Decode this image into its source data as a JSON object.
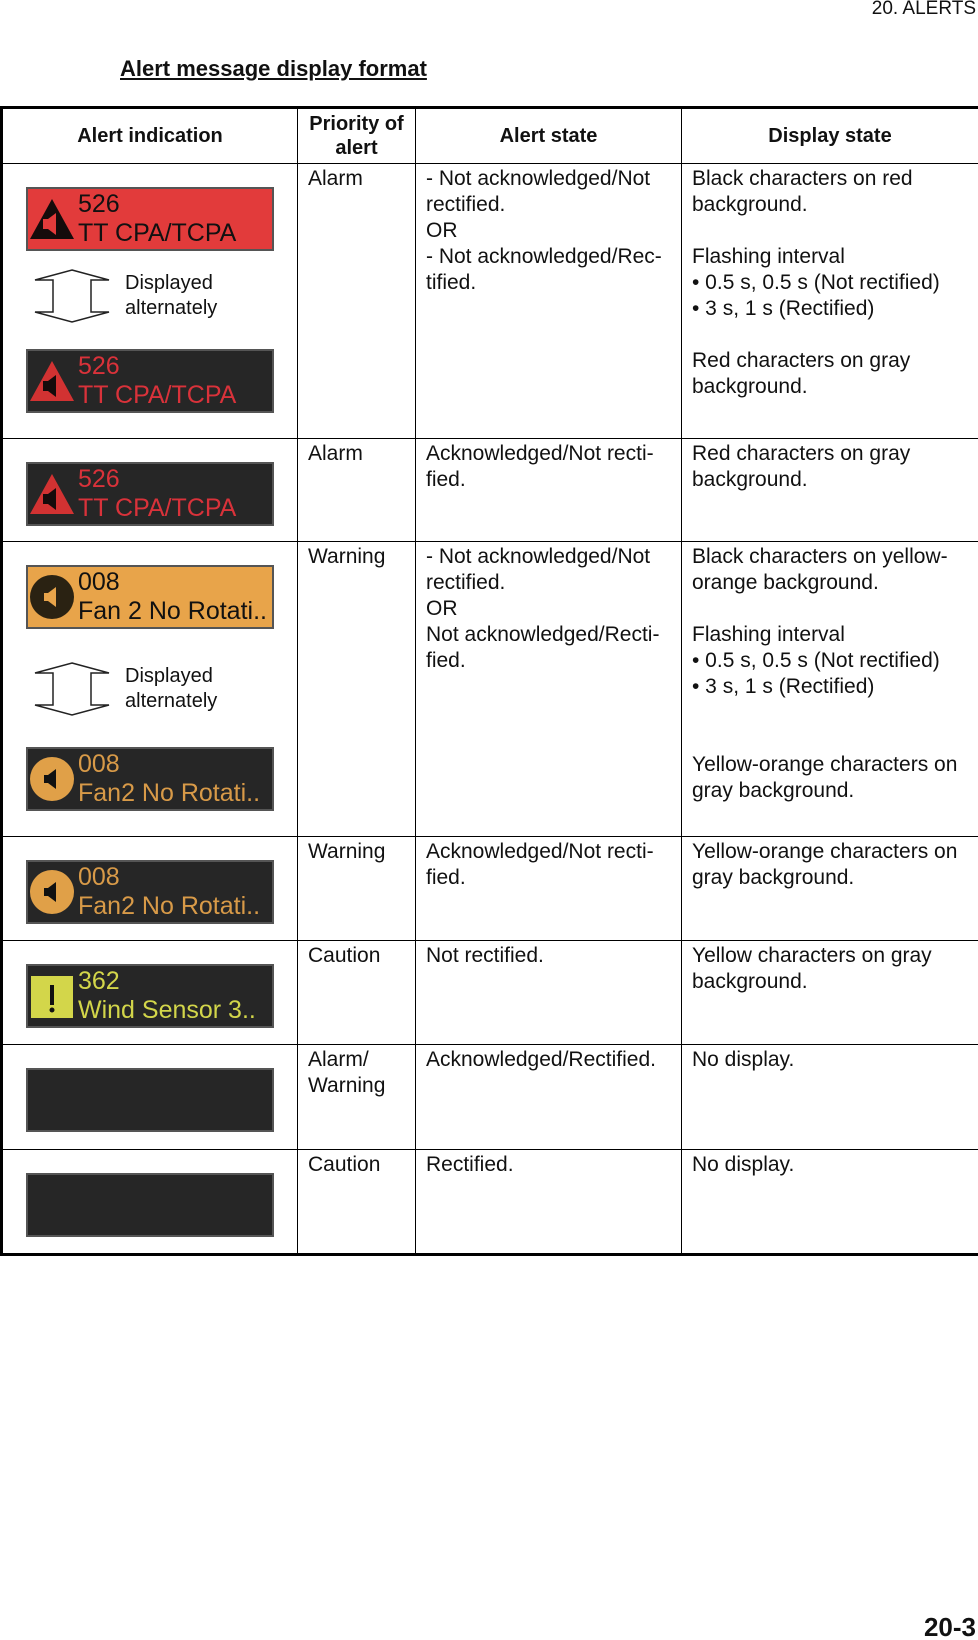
{
  "header": {
    "chapter": "20.  ALERTS",
    "page": "20-3"
  },
  "title": "Alert message display format",
  "columns": [
    "Alert indication",
    "Priority of alert",
    "Alert state",
    "Display state"
  ],
  "alternate_label": "Displayed alternately",
  "colors": {
    "red": "#e23b3b",
    "gray": "#262626",
    "orange": "#e8a44a",
    "alarm_text": "#d9323a",
    "warning_text": "#d89a48",
    "caution_text": "#d3d64a"
  },
  "rows": [
    {
      "boxes": [
        {
          "num": "526",
          "msg": "TT CPA/TCPA",
          "style": "red",
          "icon": "alarm-triangle-icon"
        },
        {
          "num": "526",
          "msg": "TT CPA/TCPA",
          "style": "gray-red",
          "icon": "alarm-triangle-icon"
        }
      ],
      "priority": "Alarm",
      "state": [
        "- Not acknowledged/Not rectified.",
        "OR",
        "- Not acknowledged/Rec-tified."
      ],
      "display": [
        "Black characters on red background.",
        "",
        "Flashing interval",
        "•  0.5 s, 0.5 s (Not rectified)",
        "•  3 s, 1 s (Rectified)",
        "",
        "Red characters on gray background."
      ]
    },
    {
      "boxes": [
        {
          "num": "526",
          "msg": "TT CPA/TCPA",
          "style": "gray-red",
          "icon": "alarm-triangle-icon"
        }
      ],
      "priority": "Alarm",
      "state": [
        "Acknowledged/Not recti-fied."
      ],
      "display": [
        "Red characters on gray background."
      ]
    },
    {
      "boxes": [
        {
          "num": "008",
          "msg": "Fan 2 No Rotati..",
          "style": "orange",
          "icon": "speaker-icon"
        },
        {
          "num": "008",
          "msg": "Fan2 No Rotati..",
          "style": "gray-orange",
          "icon": "speaker-icon"
        }
      ],
      "priority": "Warning",
      "state": [
        "- Not acknowledged/Not rectified.",
        "OR",
        "Not acknowledged/Recti-fied."
      ],
      "display": [
        "Black characters on yellow-orange background.",
        "",
        "Flashing interval",
        "•  0.5 s, 0.5 s (Not rectified)",
        "•  3 s, 1 s (Rectified)",
        "",
        "",
        "Yellow-orange characters on gray background."
      ]
    },
    {
      "boxes": [
        {
          "num": "008",
          "msg": "Fan2 No Rotati..",
          "style": "gray-orange",
          "icon": "speaker-icon"
        }
      ],
      "priority": "Warning",
      "state": [
        "Acknowledged/Not recti-fied."
      ],
      "display": [
        "Yellow-orange characters on gray background."
      ]
    },
    {
      "boxes": [
        {
          "num": "362",
          "msg": "Wind Sensor 3..",
          "style": "gray-yellow",
          "icon": "exclamation-icon"
        }
      ],
      "priority": "Caution",
      "state": [
        "Not rectified."
      ],
      "display": [
        "Yellow characters on gray background."
      ]
    },
    {
      "boxes": [
        {
          "num": "",
          "msg": "",
          "style": "gray",
          "icon": ""
        }
      ],
      "priority": "Alarm/ Warning",
      "state": [
        "Acknowledged/Rectified."
      ],
      "display": [
        "No display."
      ]
    },
    {
      "boxes": [
        {
          "num": "",
          "msg": "",
          "style": "gray",
          "icon": ""
        }
      ],
      "priority": "Caution",
      "state": [
        "Rectified."
      ],
      "display": [
        "No display."
      ]
    }
  ]
}
